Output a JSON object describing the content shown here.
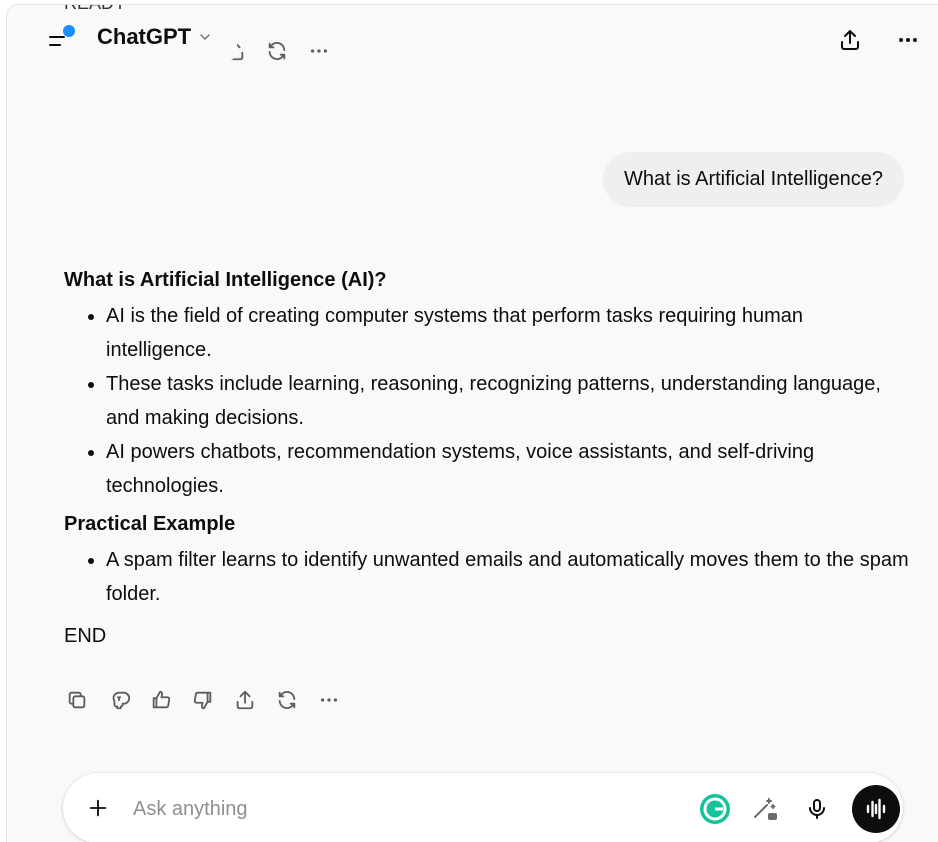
{
  "window": {
    "title": "ChatGPT"
  },
  "header": {
    "model_label": "ChatGPT",
    "sidebar_badge_color": "#1a8cff",
    "icons": [
      "sidebar-icon",
      "chevron-down-icon",
      "share-icon",
      "more-icon"
    ]
  },
  "previous_response": {
    "clipped_text": "READY",
    "actions": [
      "copy-icon",
      "read-aloud-icon",
      "thumbs-up-icon",
      "thumbs-down-icon",
      "share-icon",
      "regenerate-icon",
      "more-icon"
    ]
  },
  "conversation": {
    "user_message": "What is Artificial Intelligence?",
    "assistant": {
      "heading1": "What is Artificial Intelligence (AI)?",
      "bullets1": [
        "AI is the field of creating computer systems that perform tasks requiring human intelligence.",
        "These tasks include learning, reasoning, recognizing patterns, understanding language, and making decisions.",
        "AI powers chatbots, recommendation systems, voice assistants, and self-driving technologies."
      ],
      "heading2": "Practical Example",
      "bullets2": [
        "A spam filter learns to identify unwanted emails and automatically moves them to the spam folder."
      ],
      "end": "END",
      "actions": [
        "copy-icon",
        "brain-icon",
        "thumbs-up-icon",
        "thumbs-down-icon",
        "share-icon",
        "regenerate-icon",
        "more-icon"
      ]
    }
  },
  "composer": {
    "placeholder": "Ask anything",
    "value": "",
    "grammarly_color": "#15c39a",
    "voice_button_color": "#0d0d0d",
    "icons": [
      "plus-icon",
      "grammarly-icon",
      "magic-wand-icon",
      "microphone-icon",
      "voice-mode-icon"
    ]
  }
}
